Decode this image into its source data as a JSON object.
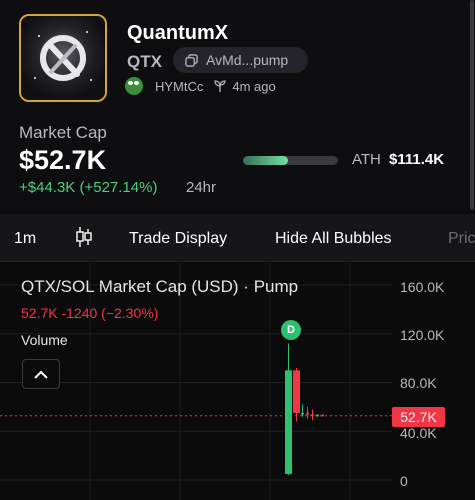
{
  "token": {
    "name": "QuantumX",
    "symbol": "QTX",
    "address": "AvMd...pump",
    "creator": "HYMtCc",
    "created": "4m ago"
  },
  "stats": {
    "mc_label": "Market Cap",
    "mc_value": "$52.7K",
    "mc_change": "+$44.3K (+527.14%)",
    "mc_period": "24hr",
    "ath_label": "ATH",
    "ath_value": "$111.4K",
    "ath_progress": 0.47
  },
  "toolbar": {
    "interval": "1m",
    "trade_display": "Trade Display",
    "hide_bubbles": "Hide All Bubbles",
    "overflow": "Pric"
  },
  "chart": {
    "title": "QTX/SOL Market Cap (USD) · Pump",
    "ohlc": "52.7K  -1240 (−2.30%)",
    "volume_label": "Volume",
    "current_tag": "52.7K",
    "marker": "D",
    "colors": {
      "up": "#2fbf71",
      "down": "#f23645",
      "grid": "#1f1f22"
    }
  },
  "chart_data": {
    "type": "candlestick",
    "ylabel": "Market Cap (USD)",
    "ylim": [
      0,
      170000
    ],
    "yticks": [
      "160.0K",
      "120.0K",
      "80.0K",
      "40.0K",
      "0"
    ],
    "ytick_values": [
      160000,
      120000,
      80000,
      40000,
      0
    ],
    "current_value": 52700,
    "candles": [
      {
        "open": 5000,
        "high": 112000,
        "low": 4000,
        "close": 90000
      },
      {
        "open": 90000,
        "high": 92000,
        "low": 48000,
        "close": 55000
      },
      {
        "open": 55000,
        "high": 62000,
        "low": 52000,
        "close": 55000
      },
      {
        "open": 55000,
        "high": 60000,
        "low": 50000,
        "close": 54000
      },
      {
        "open": 54000,
        "high": 58000,
        "low": 49000,
        "close": 52700
      },
      {
        "open": 52700,
        "high": 54000,
        "low": 52000,
        "close": 53500
      },
      {
        "open": 53500,
        "high": 54000,
        "low": 52500,
        "close": 52700
      }
    ]
  }
}
